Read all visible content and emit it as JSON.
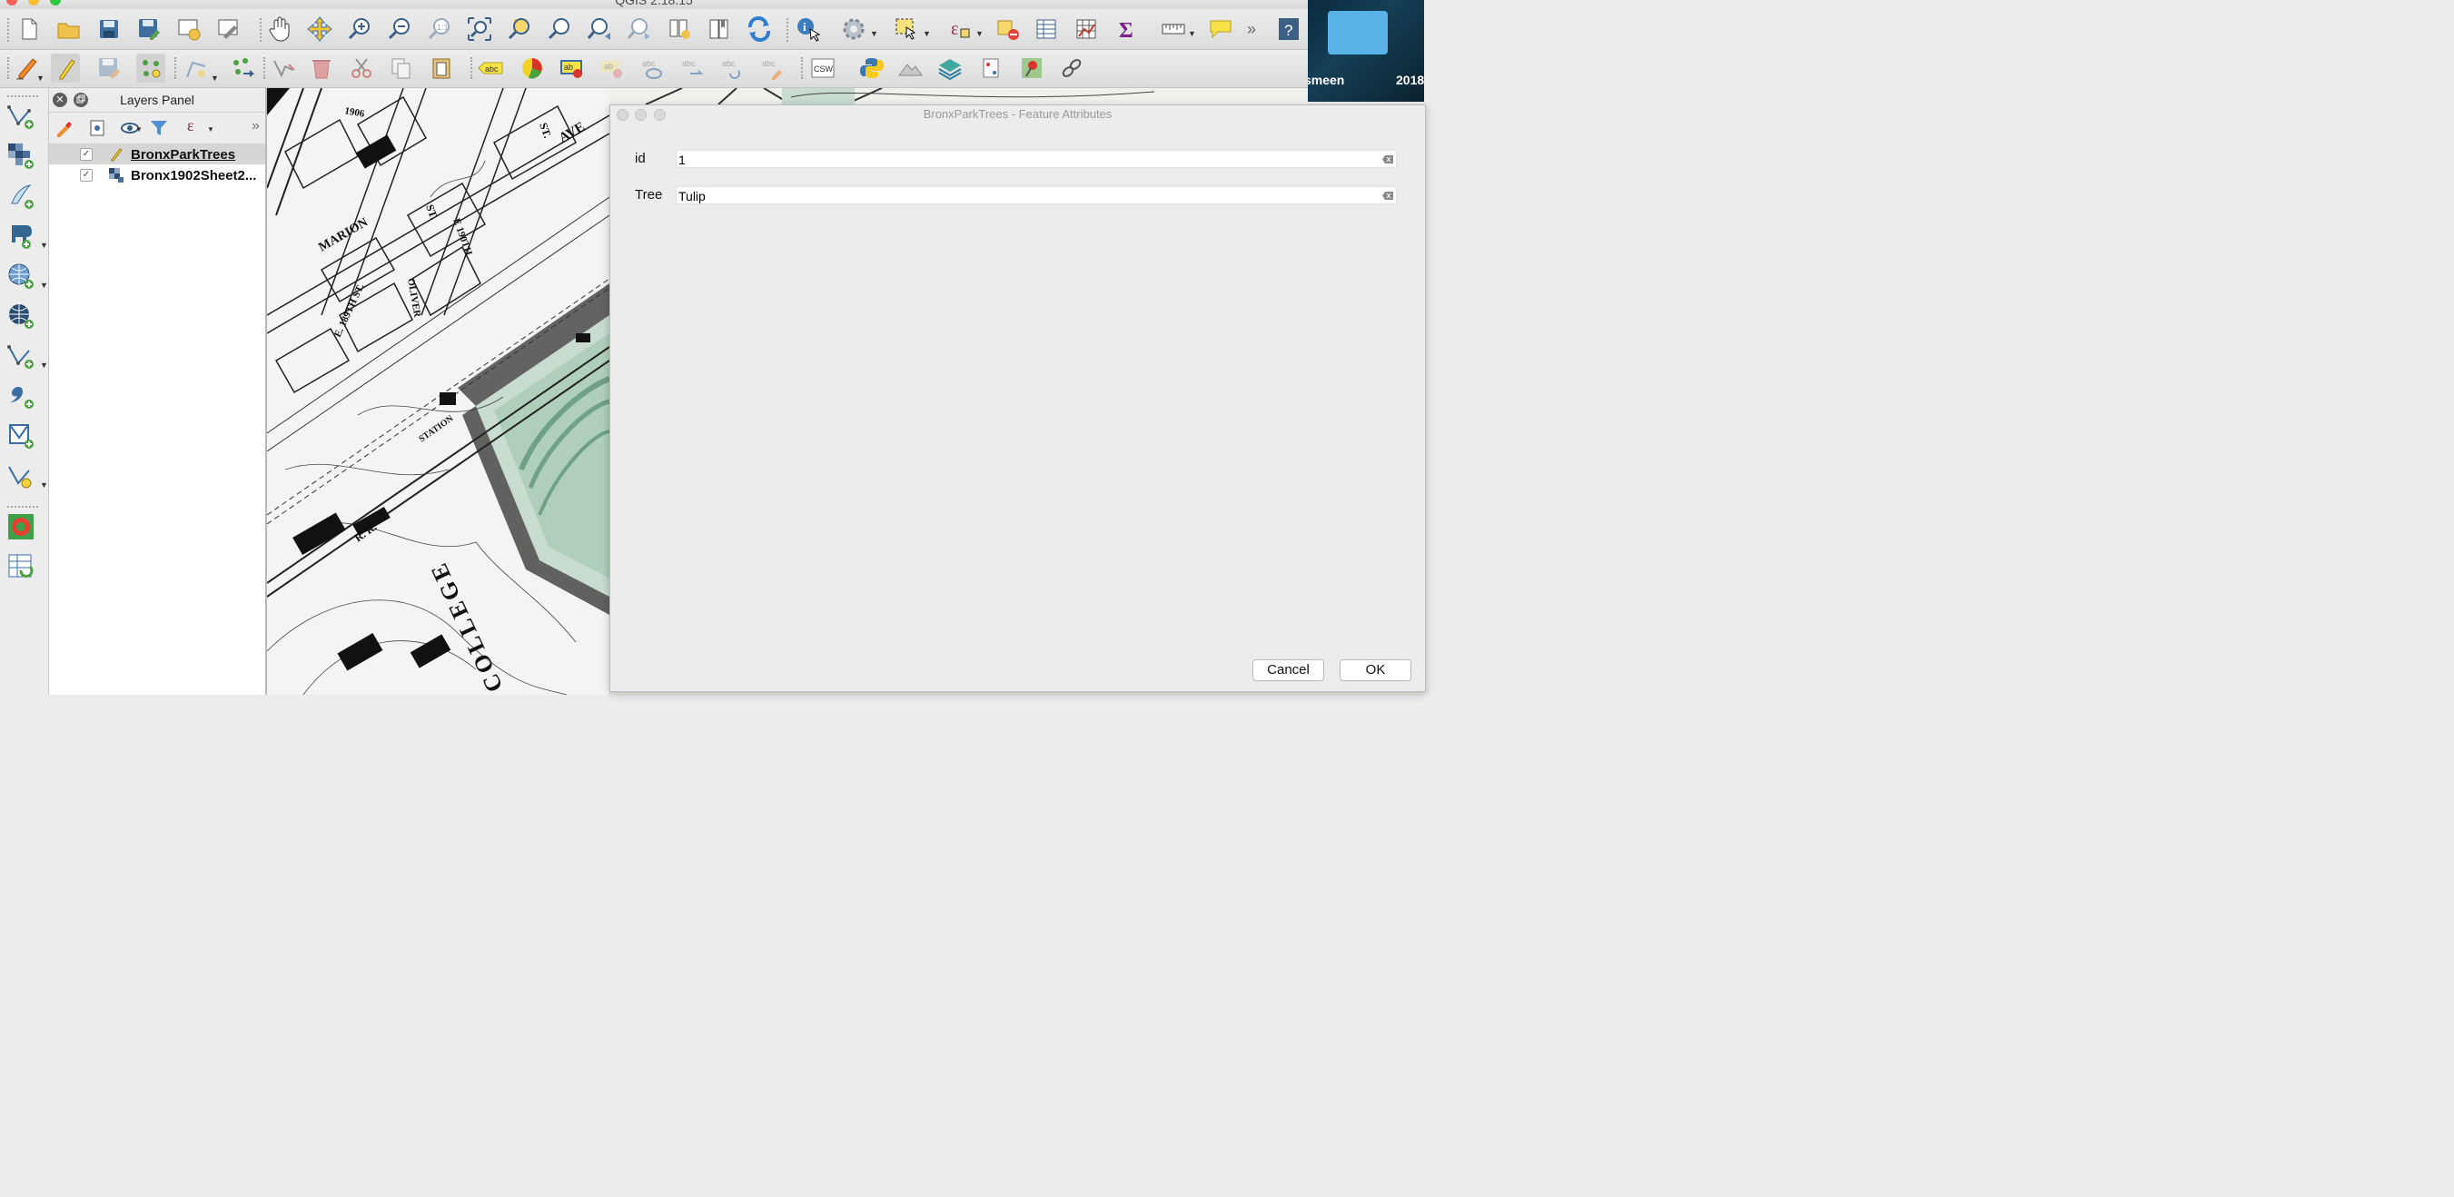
{
  "window": {
    "title": "QGIS 2.18.15"
  },
  "toolbar_top": {
    "items": [
      "new-project",
      "open-project",
      "save-project",
      "save-as",
      "new-print-composer",
      "composer-manager",
      "pan",
      "pan-to-selection",
      "zoom-in",
      "zoom-out",
      "zoom-actual",
      "zoom-full",
      "zoom-to-selection",
      "zoom-to-layer",
      "zoom-last",
      "zoom-next",
      "new-bookmark",
      "show-bookmarks",
      "refresh",
      "identify",
      "run-feature-action",
      "select-features",
      "select-by-expression",
      "deselect",
      "open-attribute-table",
      "statistics",
      "statistical-summary",
      "measure",
      "map-tips",
      "more",
      "help"
    ]
  },
  "toolbar_edit": {
    "items": [
      "current-edits",
      "toggle-editing",
      "save-layer-edits",
      "add-point-feature",
      "vertex-tool",
      "move-feature",
      "node-tool",
      "delete-selected",
      "cut-features",
      "copy-features",
      "paste-features",
      "label-tool",
      "diagram",
      "pin-labels",
      "show-hide-labels",
      "move-label",
      "rotate-label",
      "change-label",
      "csw",
      "python-console",
      "hillshade",
      "layer-styling",
      "georeferencer",
      "pin",
      "link"
    ]
  },
  "desktop": {
    "label_left": "smeen",
    "label_right": "2018"
  },
  "left_tools": [
    "add-vector-layer",
    "add-raster-layer",
    "add-delimited-text",
    "add-postgis-layer",
    "add-wms-layer",
    "add-wcs-layer",
    "add-spatialite-layer",
    "add-vector-tile",
    "new-shapefile",
    "new-spatialite",
    "gps-tool",
    "refresh-layers"
  ],
  "layers_panel": {
    "title": "Layers Panel",
    "layers": [
      {
        "name": "BronxParkTrees",
        "checked": true,
        "selected": true,
        "icon": "pencil-edit-icon"
      },
      {
        "name": "Bronx1902Sheet2...",
        "checked": true,
        "selected": false,
        "icon": "raster-layer-icon"
      }
    ]
  },
  "map_labels": [
    "AVE",
    "MARION",
    "ST.",
    "E. 189TH ST.",
    "OLIVER",
    "E 190TH",
    "ST.",
    "STATION",
    "COLLEGE",
    "R. R.",
    "1906"
  ],
  "dialog": {
    "title": "BronxParkTrees - Feature Attributes",
    "fields": [
      {
        "label": "id",
        "value": "1"
      },
      {
        "label": "Tree",
        "value": "Tulip"
      }
    ],
    "cancel_label": "Cancel",
    "ok_label": "OK"
  },
  "colors": {
    "accent": "#4a86c8",
    "chrome": "#ececec",
    "map_green": "#c8dccf"
  }
}
